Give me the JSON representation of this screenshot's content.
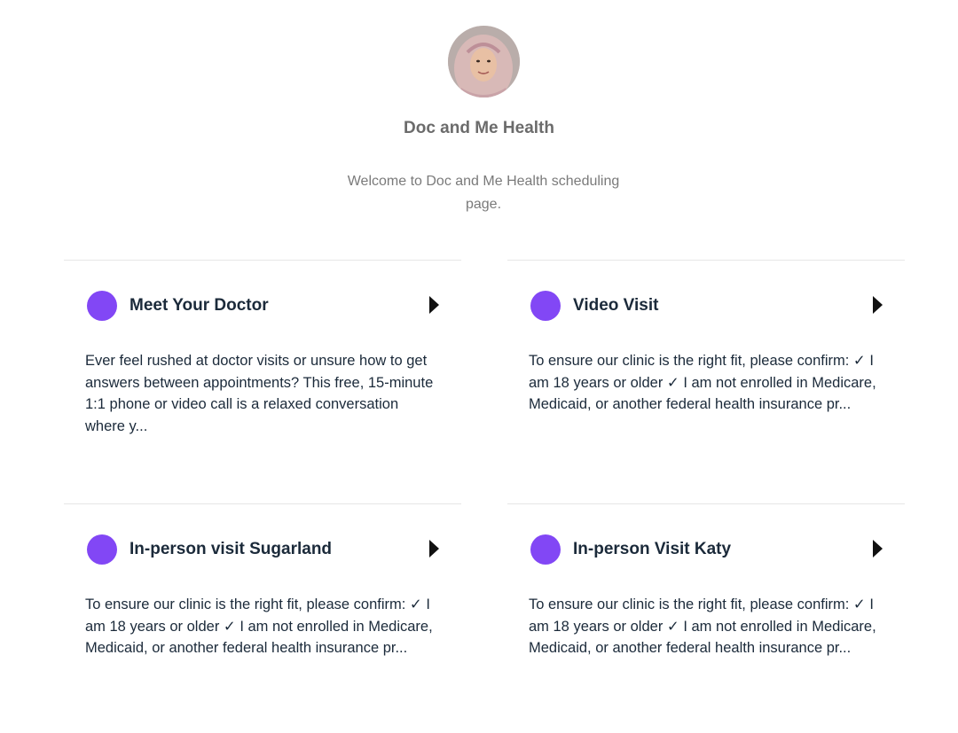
{
  "header": {
    "org_name": "Doc and Me Health",
    "welcome": "Welcome to Doc and Me Health scheduling page."
  },
  "colors": {
    "accent": "#8247f5"
  },
  "events": [
    {
      "title": "Meet Your Doctor",
      "description": "Ever feel rushed at doctor visits or unsure how to get answers between appointments? This free, 15-minute 1:1 phone or video call is a relaxed conversation where y..."
    },
    {
      "title": "Video Visit",
      "description": "To ensure our clinic is the right fit, please confirm: ✓ I am 18 years or older ✓ I am not enrolled in Medicare, Medicaid, or another federal health insurance pr..."
    },
    {
      "title": "In-person visit Sugarland",
      "description": "To ensure our clinic is the right fit, please confirm: ✓ I am 18 years or older ✓ I am not enrolled in Medicare, Medicaid, or another federal health insurance pr..."
    },
    {
      "title": "In-person Visit Katy",
      "description": "To ensure our clinic is the right fit, please confirm: ✓ I am 18 years or older ✓ I am not enrolled in Medicare, Medicaid, or another federal health insurance pr..."
    }
  ]
}
